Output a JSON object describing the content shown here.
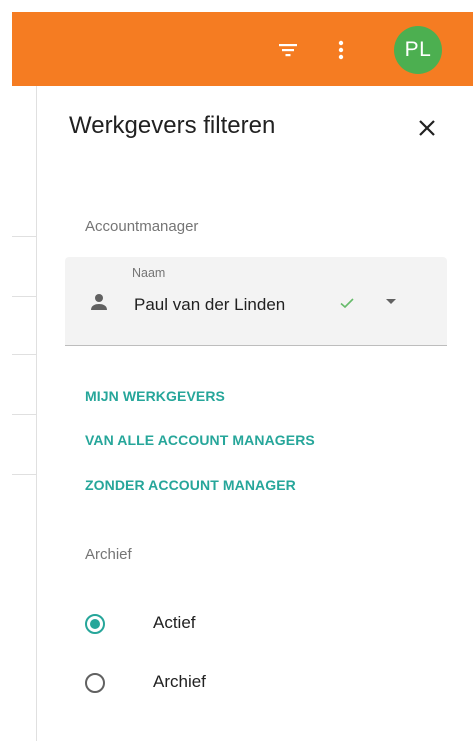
{
  "header": {
    "avatar_initials": "PL",
    "accent_color": "#f57c22",
    "avatar_color": "#4caf50",
    "icons": [
      "filter-list-icon",
      "more-vert-icon"
    ]
  },
  "drawer": {
    "title": "Werkgevers filteren",
    "close_icon": "close-icon",
    "accountmanager": {
      "section_label": "Accountmanager",
      "field_label": "Naam",
      "selected_value": "Paul van der Linden",
      "icons": [
        "person-icon",
        "check-icon",
        "arrow-drop-down-icon"
      ]
    },
    "quick_filters": [
      {
        "label": "MIJN WERKGEVERS"
      },
      {
        "label": "VAN ALLE ACCOUNT MANAGERS"
      },
      {
        "label": "ZONDER ACCOUNT MANAGER"
      }
    ],
    "archief": {
      "section_label": "Archief",
      "options": [
        {
          "label": "Actief",
          "selected": true
        },
        {
          "label": "Archief",
          "selected": false
        }
      ]
    },
    "link_color": "#26a69a"
  }
}
